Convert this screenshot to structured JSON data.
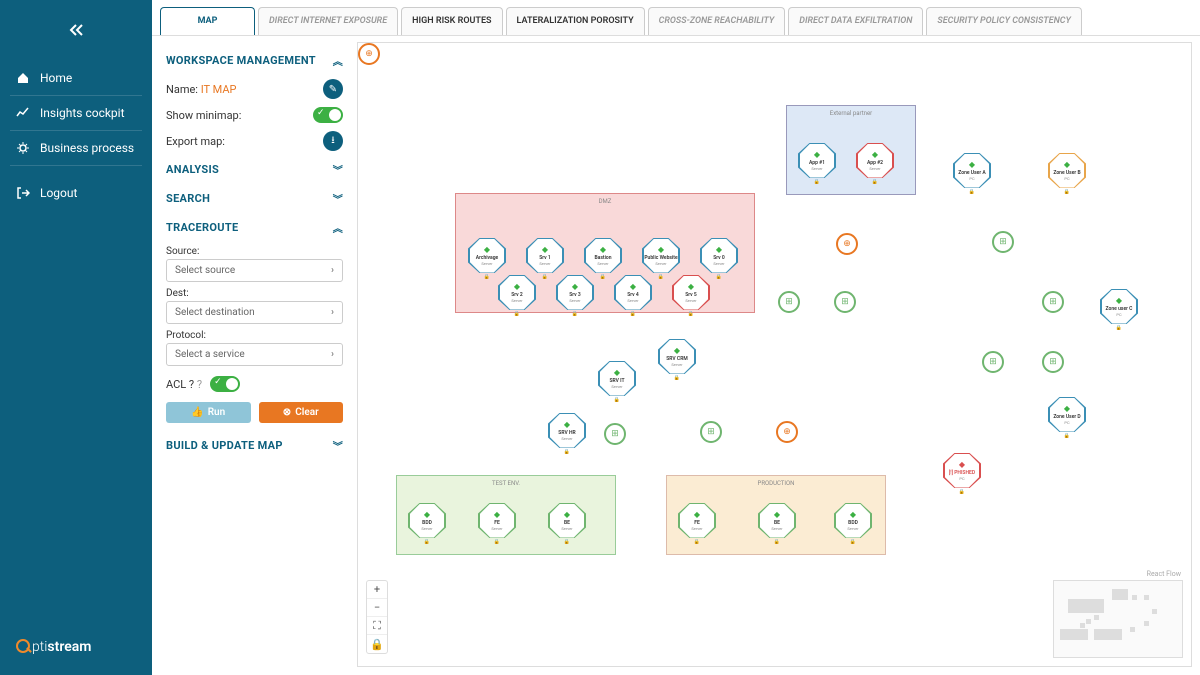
{
  "sidebar": {
    "items": [
      {
        "label": "Home",
        "icon": "home"
      },
      {
        "label": "Insights cockpit",
        "icon": "chart"
      },
      {
        "label": "Business process",
        "icon": "gear"
      },
      {
        "label": "Logout",
        "icon": "logout"
      }
    ]
  },
  "logo": {
    "a": "pti",
    "b": "stream"
  },
  "tabs": [
    {
      "label": "MAP"
    },
    {
      "label": "DIRECT INTERNET EXPOSURE"
    },
    {
      "label": "HIGH RISK ROUTES"
    },
    {
      "label": "LATERALIZATION POROSITY"
    },
    {
      "label": "CROSS-ZONE REACHABILITY"
    },
    {
      "label": "DIRECT DATA EXFILTRATION"
    },
    {
      "label": "SECURITY POLICY CONSISTENCY"
    }
  ],
  "panel": {
    "workspace_h": "WORKSPACE MANAGEMENT",
    "name_l": "Name:",
    "name_v": "IT MAP",
    "minimap_l": "Show minimap:",
    "export_l": "Export map:",
    "analysis_h": "ANALYSIS",
    "search_h": "SEARCH",
    "trace_h": "TRACEROUTE",
    "src_l": "Source:",
    "src_ph": "Select source",
    "dst_l": "Dest:",
    "dst_ph": "Select destination",
    "proto_l": "Protocol:",
    "proto_ph": "Select a service",
    "acl_l": "ACL ?",
    "acl_help": "?",
    "run": "Run",
    "clear": "Clear",
    "build_h": "BUILD & UPDATE MAP"
  },
  "zones": {
    "dmz": "DMZ",
    "ext": "External partner",
    "test": "TEST ENV.",
    "prod": "PRODUCTION"
  },
  "nodes": {
    "archi": {
      "n": "Archivage",
      "s": "Server"
    },
    "srv1": {
      "n": "Srv 1",
      "s": "Server"
    },
    "bastion": {
      "n": "Bastion",
      "s": "Server"
    },
    "pubweb": {
      "n": "Public Website",
      "s": "Server"
    },
    "srv0": {
      "n": "Srv 0",
      "s": "Server"
    },
    "srv2": {
      "n": "Srv 2",
      "s": "Server"
    },
    "srv3": {
      "n": "Srv 3",
      "s": "Server"
    },
    "srv4": {
      "n": "Srv 4",
      "s": "Server"
    },
    "srv5": {
      "n": "Srv 5",
      "s": "Server"
    },
    "app1": {
      "n": "App #1",
      "s": "Server"
    },
    "app2": {
      "n": "App #2",
      "s": "Server"
    },
    "ua": {
      "n": "Zone User A",
      "s": "PC"
    },
    "ub": {
      "n": "Zone User B",
      "s": "PC"
    },
    "uc": {
      "n": "Zone user C",
      "s": "PC"
    },
    "ud": {
      "n": "Zone User D",
      "s": "PC"
    },
    "crm": {
      "n": "SRV CRM",
      "s": "Server"
    },
    "it": {
      "n": "SRV IT",
      "s": "Server"
    },
    "hr": {
      "n": "SRV HR",
      "s": "Server"
    },
    "phish": {
      "n": "[!] PHISHED",
      "s": "PC"
    },
    "tbdd": {
      "n": "BDD",
      "s": "Server"
    },
    "tfe": {
      "n": "FE",
      "s": "Server"
    },
    "tbe": {
      "n": "BE",
      "s": "Server"
    },
    "pfe": {
      "n": "FE",
      "s": "Server"
    },
    "pbe": {
      "n": "BE",
      "s": "Server"
    },
    "pbdd": {
      "n": "BDD",
      "s": "Server"
    }
  },
  "attrib": "React Flow"
}
